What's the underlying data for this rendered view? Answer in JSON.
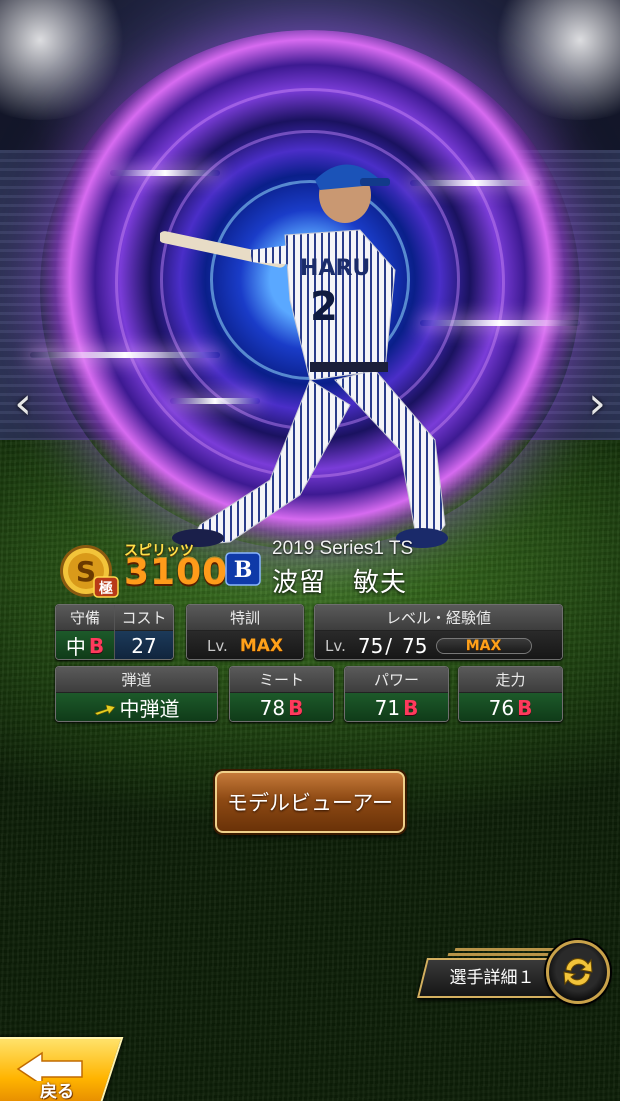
{
  "card": {
    "spirits_label": "スピリッツ",
    "spirits_value": "3100",
    "rank": "S",
    "rank_sub": "極",
    "series": "2019 Series1 TS",
    "player_name": "波留　敏夫",
    "uniform_name": "HARU",
    "uniform_number": "2",
    "team_logo": "B"
  },
  "stats": {
    "defense": {
      "label": "守備",
      "position": "中",
      "grade": "B"
    },
    "cost": {
      "label": "コスト",
      "value": "27"
    },
    "special_training": {
      "label": "特訓",
      "lv_prefix": "Lv.",
      "value": "MAX"
    },
    "level": {
      "label": "レベル・経験値",
      "lv_prefix": "Lv.",
      "current": "75",
      "separator": "/",
      "max": "75",
      "exp_text": "MAX"
    },
    "trajectory": {
      "label": "弾道",
      "value": "中弾道"
    },
    "contact": {
      "label": "ミート",
      "value": "78",
      "grade": "B"
    },
    "power": {
      "label": "パワー",
      "value": "71",
      "grade": "B"
    },
    "speed": {
      "label": "走力",
      "value": "76",
      "grade": "B"
    }
  },
  "buttons": {
    "model_viewer": "モデルビューアー",
    "player_detail": "選手詳細１",
    "back": "戻る"
  },
  "nav": {
    "prev": "‹",
    "next": "›"
  },
  "icons": {
    "prev": "chevron-left-icon",
    "next": "chevron-right-icon",
    "trajectory": "arrow-up-right-icon",
    "refresh": "refresh-icon",
    "back": "back-arrow-icon"
  },
  "colors": {
    "grade_b": "#ff3a5c",
    "max": "#ffa11a",
    "spirits": "#ff9b1a",
    "stat_green": "#1d5a2a",
    "button_brown": "#8e4a14",
    "back_yellow": "#ffb400"
  }
}
